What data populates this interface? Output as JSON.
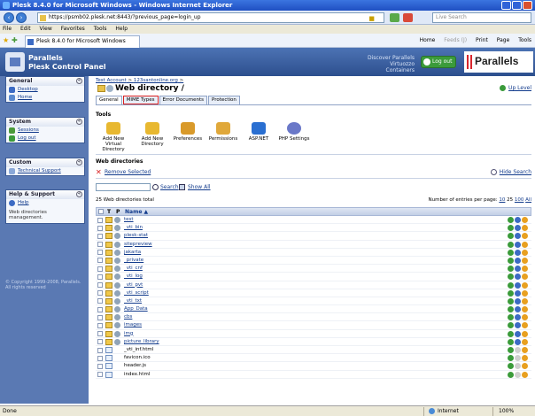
{
  "window": {
    "title": "Plesk 8.4.0 for Microsoft Windows - Windows Internet Explorer"
  },
  "browser": {
    "address": "https://psmb02.plesk.net:8443/?previous_page=login_up",
    "search_placeholder": "Live Search",
    "menu": [
      "File",
      "Edit",
      "View",
      "Favorites",
      "Tools",
      "Help"
    ],
    "tab_label": "Plesk 8.4.0 for Microsoft Windows",
    "toolbar": {
      "home": "Home",
      "feeds": "Feeds (J)",
      "print": "Print",
      "page": "Page",
      "tools": "Tools"
    }
  },
  "header": {
    "brand_line1": "Parallels",
    "brand_line2": "Plesk Control Panel",
    "discover_line1": "Discover Parallels",
    "discover_line2": "Virtuozzo Containers",
    "logout": "Log out",
    "logo_text": "Parallels"
  },
  "sidebar": {
    "general": {
      "title": "General",
      "items": [
        "Desktop",
        "Home"
      ]
    },
    "system": {
      "title": "System",
      "items": [
        "Sessions",
        "Log out"
      ]
    },
    "custom": {
      "title": "Custom",
      "items": [
        "Technical Support"
      ]
    },
    "help": {
      "title": "Help & Support",
      "items": [
        "Help"
      ],
      "text": "Web directories management."
    },
    "copyright": "© Copyright 1999-2008, Parallels. All rights reserved"
  },
  "main": {
    "breadcrumb": [
      "Test Account",
      "123santonline.org"
    ],
    "title": "Web directory /",
    "uplevel": "Up Level",
    "tabs": [
      "General",
      "MIME Types",
      "Error Documents",
      "Protection"
    ],
    "tools_title": "Tools",
    "tools": [
      {
        "label": "Add New Virtual Directory",
        "icon": "add-virtual-directory-icon",
        "color": "#e8b830"
      },
      {
        "label": "Add New Directory",
        "icon": "add-directory-icon",
        "color": "#e8b830"
      },
      {
        "label": "Preferences",
        "icon": "preferences-icon",
        "color": "#d99a2a"
      },
      {
        "label": "Permissions",
        "icon": "permissions-icon",
        "color": "#e0a83a"
      },
      {
        "label": "ASP.NET",
        "icon": "asp-net-icon",
        "color": "#2a6fd1"
      },
      {
        "label": "PHP Settings",
        "icon": "php-icon",
        "color": "#6a78c8"
      }
    ],
    "webdirs_title": "Web directories",
    "remove_selected": "Remove Selected",
    "hide_search": "Hide Search",
    "search_button": "Search",
    "show_all": "Show All",
    "total": "25 Web directories total",
    "per_page_label": "Number of entries per page:",
    "per_page_options": [
      "10",
      "25",
      "100",
      "All"
    ],
    "columns": {
      "t": "T",
      "p": "P",
      "name": "Name ▲"
    },
    "rows": [
      {
        "name": "test",
        "type": "dir",
        "p": true,
        "link": true
      },
      {
        "name": "_vti_bin",
        "type": "dir",
        "p": true,
        "link": true
      },
      {
        "name": "plesk-stat",
        "type": "dir",
        "p": true,
        "link": true
      },
      {
        "name": "sitepreview",
        "type": "dir",
        "p": true,
        "link": true
      },
      {
        "name": "jakarta",
        "type": "dir",
        "p": true,
        "link": true
      },
      {
        "name": "_private",
        "type": "dir",
        "p": true,
        "link": true
      },
      {
        "name": "_vti_cnf",
        "type": "dir",
        "p": true,
        "link": true
      },
      {
        "name": "_vti_log",
        "type": "dir",
        "p": true,
        "link": true
      },
      {
        "name": "_vti_pvt",
        "type": "dir",
        "p": true,
        "link": true
      },
      {
        "name": "_vti_script",
        "type": "dir",
        "p": true,
        "link": true
      },
      {
        "name": "_vti_txt",
        "type": "dir",
        "p": true,
        "link": true
      },
      {
        "name": "App_Data",
        "type": "dir",
        "p": true,
        "link": true
      },
      {
        "name": "cbs",
        "type": "dir",
        "p": true,
        "link": true
      },
      {
        "name": "images",
        "type": "dir",
        "p": true,
        "link": true
      },
      {
        "name": "img",
        "type": "dir",
        "p": true,
        "link": true
      },
      {
        "name": "picture_library",
        "type": "dir",
        "p": true,
        "link": true
      },
      {
        "name": "_vti_inf.html",
        "type": "file",
        "p": false,
        "link": false
      },
      {
        "name": "favicon.ico",
        "type": "file",
        "p": false,
        "link": false
      },
      {
        "name": "header.js",
        "type": "file",
        "p": false,
        "link": false
      },
      {
        "name": "index.html",
        "type": "file",
        "p": false,
        "link": false
      }
    ]
  },
  "status": {
    "left": "Done",
    "zone": "Internet",
    "zoom": "100%"
  },
  "colors": {
    "accent": "#2d4f8e",
    "link": "#123b8c",
    "highlight": "#d92020"
  }
}
